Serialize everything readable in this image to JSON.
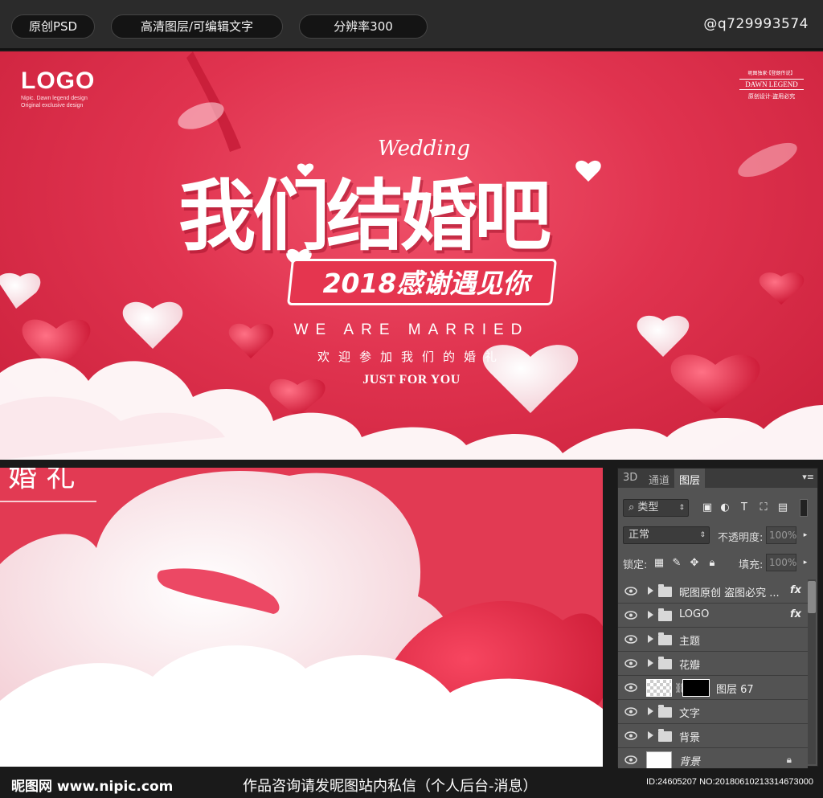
{
  "topbar": {
    "pills": [
      "原创PSD",
      "高清图层/可编辑文字",
      "分辨率300"
    ],
    "contact": "@q729993574"
  },
  "banner": {
    "logo": "LOGO",
    "logo_sub_1": "Nipic. Dawn legend design",
    "logo_sub_2": "Original exclusive design",
    "seal_line_1": "昵图独家·【登朗传说】",
    "seal_line_2": "DAWN LEGEND",
    "seal_line_3": "原创设计·盗用必究",
    "wedding_script": "Wedding",
    "title": "我们结婚吧",
    "subtitle": "2018感谢遇见你",
    "married": "WE ARE MARRIED",
    "welcome": "欢迎参加我们的婚礼",
    "just_for_you": "JUST FOR YOU"
  },
  "zoom": {
    "text": "婚 礼"
  },
  "layers_panel": {
    "tabs": [
      "3D",
      "通道",
      "图层"
    ],
    "active_tab": "图层",
    "filter_label": "类型",
    "blend_mode": "正常",
    "opacity_label": "不透明度:",
    "opacity_value": "100%",
    "lock_label": "锁定:",
    "fill_label": "填充:",
    "fill_value": "100%",
    "layers": [
      {
        "name": "昵图原创 盗图必究 ...",
        "type": "folder",
        "fx": "fx"
      },
      {
        "name": "LOGO",
        "type": "folder",
        "fx": "fx"
      },
      {
        "name": "主题",
        "type": "folder",
        "fx": ""
      },
      {
        "name": "花瓣",
        "type": "folder",
        "fx": ""
      },
      {
        "name": "图层 67",
        "type": "masked",
        "fx": ""
      },
      {
        "name": "文字",
        "type": "folder",
        "fx": ""
      },
      {
        "name": "背景",
        "type": "folder",
        "fx": ""
      },
      {
        "name": "背景",
        "type": "background",
        "fx": ""
      }
    ]
  },
  "bottombar": {
    "site": "昵图网 www.nipic.com",
    "notice": "作品咨询请发昵图站内私信（个人后台-消息）",
    "id": "ID:24605207 NO:20180610213314673000"
  },
  "colors": {
    "accent_red": "#e0334f",
    "panel_gray": "#535353",
    "dark_bg": "#1a1a1a"
  }
}
